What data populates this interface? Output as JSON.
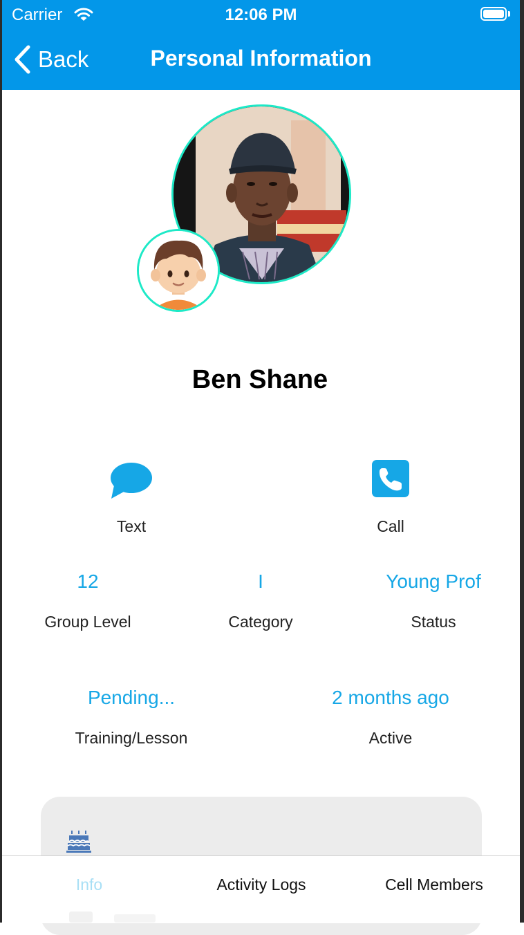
{
  "status_bar": {
    "carrier": "Carrier",
    "time": "12:06 PM"
  },
  "nav": {
    "back_label": "Back",
    "title": "Personal Information"
  },
  "profile": {
    "name": "Ben Shane"
  },
  "actions": [
    {
      "label": "Text",
      "icon": "chat-bubble-icon"
    },
    {
      "label": "Call",
      "icon": "phone-icon"
    }
  ],
  "stats_row1": [
    {
      "value": "12",
      "label": "Group Level"
    },
    {
      "value": "I",
      "label": "Category"
    },
    {
      "value": "Young Prof",
      "label": "Status"
    }
  ],
  "stats_row2": [
    {
      "value": "Pending...",
      "label": "Training/Lesson"
    },
    {
      "value": "2 months ago",
      "label": "Active"
    }
  ],
  "tabs": [
    {
      "label": "Info",
      "active": true
    },
    {
      "label": "Activity Logs",
      "active": false
    },
    {
      "label": "Cell Members",
      "active": false
    }
  ],
  "colors": {
    "header": "#0397e9",
    "accent": "#16a7e6",
    "ring": "#1de9c7",
    "card": "#ececec"
  }
}
